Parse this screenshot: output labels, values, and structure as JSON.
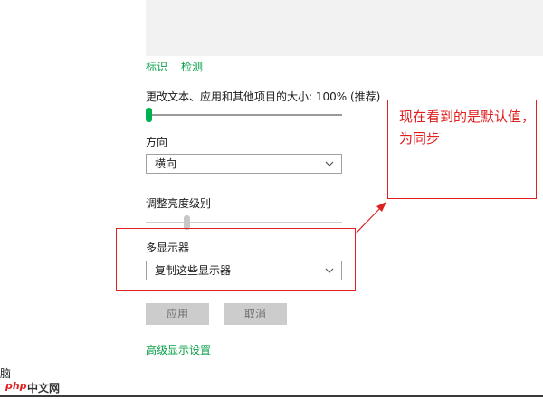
{
  "links": {
    "identify": "标识",
    "detect": "检测",
    "advanced": "高级显示设置"
  },
  "scale": {
    "label": "更改文本、应用和其他项目的大小: 100% (推荐)",
    "value_percent": 0
  },
  "orientation": {
    "label": "方向",
    "selected": "横向"
  },
  "brightness": {
    "label": "调整亮度级别",
    "value_percent": 20
  },
  "multi_display": {
    "label": "多显示器",
    "selected": "复制这些显示器"
  },
  "buttons": {
    "apply": "应用",
    "cancel": "取消"
  },
  "annotation": {
    "text": "现在看到的是默认值，为同步",
    "color": "#e02020"
  },
  "edge_text": "脑",
  "watermark": {
    "logo": "php",
    "text": "中文网"
  },
  "colors": {
    "accent": "#00b050",
    "link": "#0aa14a",
    "annotation": "#e02020"
  }
}
